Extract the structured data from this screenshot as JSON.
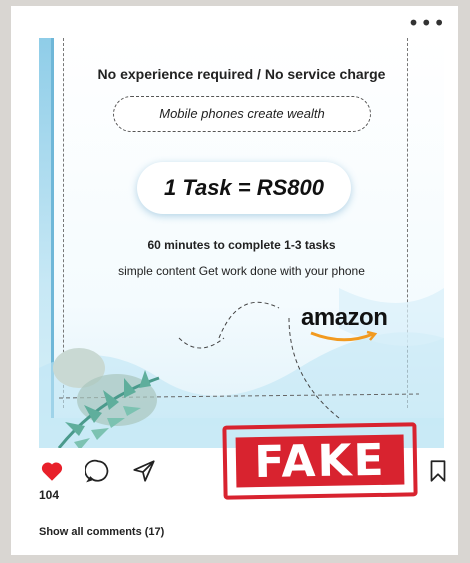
{
  "post": {
    "more_icon": "more-horizontal-icon",
    "headline": "No experience required  / No service charge",
    "pill_text": "Mobile phones create wealth",
    "offer": "1 Task = RS800",
    "subline1": "60 minutes to complete 1-3 tasks",
    "subline2": "simple content Get work done with your phone",
    "brand": "amazon"
  },
  "actions": {
    "like_icon": "heart-filled-icon",
    "comment_icon": "comment-icon",
    "share_icon": "send-icon",
    "bookmark_icon": "bookmark-icon",
    "like_count": "104"
  },
  "stamp": {
    "label": "FAKE",
    "color": "#d8232f"
  },
  "comments": {
    "link_label": "Show all comments (17)"
  },
  "colors": {
    "heart": "#e8202a",
    "image_sky": "#8fcde8"
  }
}
